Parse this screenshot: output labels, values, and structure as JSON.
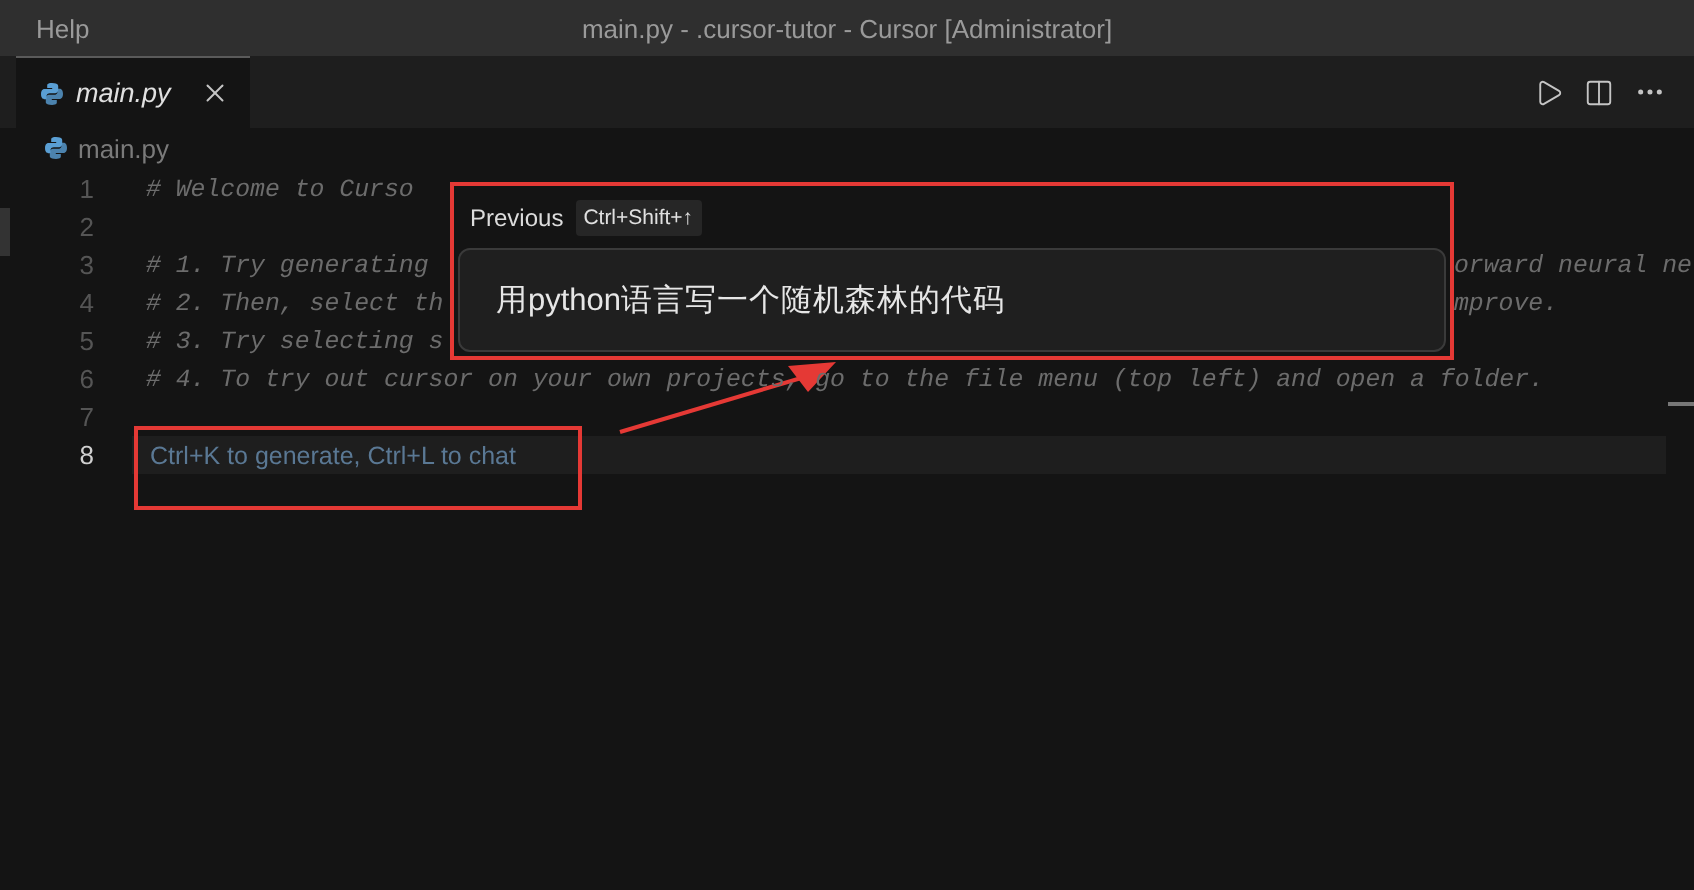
{
  "window": {
    "menu": "Help",
    "title": "main.py - .cursor-tutor - Cursor [Administrator]"
  },
  "tabs": [
    {
      "label": "main.py",
      "selected": true
    }
  ],
  "breadcrumb": [
    "main.py"
  ],
  "editor": {
    "lines": [
      {
        "number": "1",
        "active": false,
        "left": "# Welcome to Curso"
      },
      {
        "number": "2",
        "active": false
      },
      {
        "number": "3",
        "active": false,
        "left": "# 1. Try generating",
        "right": "orward neural ne"
      },
      {
        "number": "4",
        "active": false,
        "left": "# 2. Then, select th",
        "right": "mprove."
      },
      {
        "number": "5",
        "active": false,
        "left": "# 3. Try selecting s"
      },
      {
        "number": "6",
        "active": false,
        "full": "# 4. To try out cursor on your own projects, go to the file menu (top left) and open a folder."
      },
      {
        "number": "7",
        "active": false
      },
      {
        "number": "8",
        "active": true,
        "placeholder": "Ctrl+K to generate, Ctrl+L to chat"
      }
    ]
  },
  "prompt_popup": {
    "label": "Previous",
    "shortcut": "Ctrl+Shift+↑",
    "value": "用python语言写一个随机森林的代码"
  }
}
